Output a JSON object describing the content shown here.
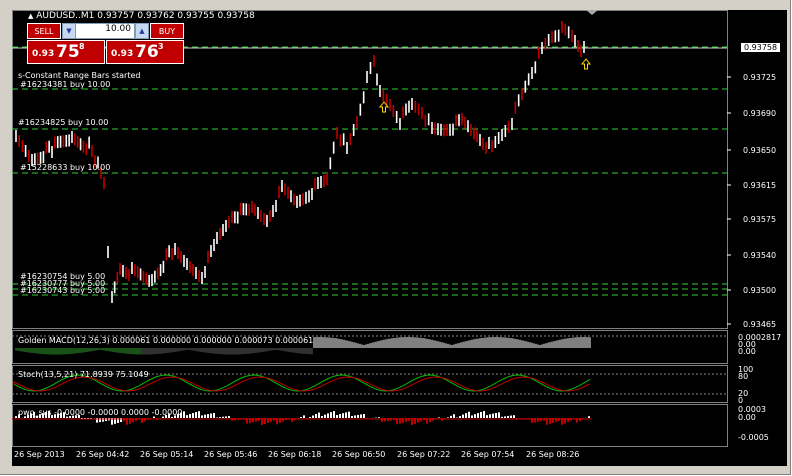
{
  "header": {
    "title": "AUDUSD..M1  0.93757 0.93762 0.93755 0.93758"
  },
  "trade_panel": {
    "sell_label": "SELL",
    "buy_label": "BUY",
    "lot_value": "10.00",
    "bid": {
      "prefix": "0.93",
      "big": "75",
      "sup": "8"
    },
    "ask": {
      "prefix": "0.93",
      "big": "76",
      "sup": "3"
    }
  },
  "ea_status": "s-Constant Range Bars started",
  "order_labels": [
    {
      "text": "#16234381 buy 10.00"
    },
    {
      "text": "#16234825 buy 10.00"
    },
    {
      "text": "#15228633 buy 10.00"
    },
    {
      "text": "#16230754 buy 5.00"
    },
    {
      "text": "#16230777 buy 5.00"
    },
    {
      "text": "#16230743 buy 5.00"
    }
  ],
  "price_axis": {
    "current": "0.93758",
    "ticks": [
      "0.93725",
      "0.93690",
      "0.93650",
      "0.93615",
      "0.93575",
      "0.93540",
      "0.93500",
      "0.93465"
    ]
  },
  "time_axis": [
    "26 Sep 2013",
    "26 Sep 04:42",
    "26 Sep 05:14",
    "26 Sep 05:46",
    "26 Sep 06:18",
    "26 Sep 06:50",
    "26 Sep 07:22",
    "26 Sep 07:54",
    "26 Sep 08:26"
  ],
  "indicators": {
    "macd": {
      "label": "Golden MACD(12,26,3) 0.000061 0.000000 0.000000 0.000073 0.000061",
      "ticks": [
        "0.0002817",
        "0.00",
        "0.00"
      ]
    },
    "stoch": {
      "label": "Stoch(13,5,21) 71.8939 75.1049",
      "ticks": [
        "100",
        "80",
        "20",
        "0"
      ]
    },
    "pwo": {
      "label": "pwo_svs -0.0000 -0.0000 0.0000 -0.0000",
      "ticks": [
        "0.0003",
        "0.00",
        "-0.0005"
      ]
    }
  },
  "colors": {
    "bull": "#ffffff",
    "bear": "#c00000",
    "grid_line": "#33cc33",
    "background": "#000000",
    "arrow": "#ffd700"
  }
}
